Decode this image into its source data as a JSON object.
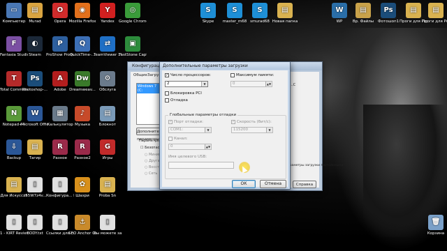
{
  "desktop": {
    "icons": [
      {
        "label": "Компьютер",
        "icon": "computer-icon",
        "color": "#4a78b5",
        "glyph": "▭"
      },
      {
        "label": "Murad",
        "icon": "folder-icon",
        "color": "#d9a441",
        "glyph": "▤"
      },
      {
        "label": "Opera",
        "icon": "opera-icon",
        "color": "#d12b2b",
        "glyph": "O"
      },
      {
        "label": "Mozilla Firefox",
        "icon": "firefox-icon",
        "color": "#e3701c",
        "glyph": "◉"
      },
      {
        "label": "Yandex",
        "icon": "yandex-icon",
        "color": "#d22020",
        "glyph": "Y"
      },
      {
        "label": "Google Chrome",
        "icon": "chrome-icon",
        "color": "#3a9b3a",
        "glyph": "◎"
      },
      {
        "label": "Skype",
        "icon": "skype-icon",
        "color": "#1e8fd6",
        "glyph": "S"
      },
      {
        "label": "master_m68",
        "icon": "skype-icon",
        "color": "#1e8fd6",
        "glyph": "S"
      },
      {
        "label": "smurad68",
        "icon": "skype-icon",
        "color": "#1e8fd6",
        "glyph": "S"
      },
      {
        "label": "Новая папка",
        "icon": "folder-icon",
        "color": "#d9b250",
        "glyph": "▤"
      },
      {
        "label": "WP",
        "icon": "wordpress-icon",
        "color": "#2a6ea8",
        "glyph": "W"
      },
      {
        "label": "Вр. Файлы",
        "icon": "folder-icon",
        "color": "#c9a24a",
        "glyph": "▤"
      },
      {
        "label": "Фотошоп1",
        "icon": "photoshop-icon",
        "color": "#1b4d7a",
        "glyph": "Ps"
      },
      {
        "label": "Проги для Рерайта",
        "icon": "folder-icon",
        "color": "#d9b250",
        "glyph": "▤"
      },
      {
        "label": "Проги для Рерайта",
        "icon": "folder-icon",
        "color": "#d9b250",
        "glyph": "▤"
      },
      {
        "label": "Fantasia Studio 7",
        "icon": "fantasia-icon",
        "color": "#7b4fa3",
        "glyph": "F"
      },
      {
        "label": "Steam",
        "icon": "steam-icon",
        "color": "#1b2838",
        "glyph": "◐"
      },
      {
        "label": "ProShow Producer",
        "icon": "proshow-icon",
        "color": "#2d5f9e",
        "glyph": "P"
      },
      {
        "label": "QuickTime-...",
        "icon": "quicktime-icon",
        "color": "#3c6fb6",
        "glyph": "Q"
      },
      {
        "label": "TeamViewer 10",
        "icon": "teamviewer-icon",
        "color": "#1f6fc5",
        "glyph": "⇄"
      },
      {
        "label": "FastStone Capture",
        "icon": "faststone-icon",
        "color": "#2d8c3c",
        "glyph": "▣"
      },
      {
        "label": "Total Commander",
        "icon": "totalcmd-icon",
        "color": "#b52a2a",
        "glyph": "T"
      },
      {
        "label": "Photoshop-...",
        "icon": "photoshop-icon",
        "color": "#1b4d7a",
        "glyph": "Ps"
      },
      {
        "label": "Adobe",
        "icon": "adobe-icon",
        "color": "#b31e1e",
        "glyph": "A"
      },
      {
        "label": "Dreamweav...",
        "icon": "dreamweaver-icon",
        "color": "#3a7a2a",
        "glyph": "Dw"
      },
      {
        "label": "Обслуга",
        "icon": "service-icon",
        "color": "#6b7b8c",
        "glyph": "⚙"
      },
      {
        "label": "Notepad++",
        "icon": "notepad-icon",
        "color": "#5a9a3a",
        "glyph": "N"
      },
      {
        "label": "Microsoft Office W...",
        "icon": "word-icon",
        "color": "#2b5797",
        "glyph": "W"
      },
      {
        "label": "Калькулятор",
        "icon": "calculator-icon",
        "color": "#6a7a8a",
        "glyph": "▦"
      },
      {
        "label": "Музыка",
        "icon": "music-icon",
        "color": "#c74a2a",
        "glyph": "♪"
      },
      {
        "label": "Блокнот",
        "icon": "notepad-icon",
        "color": "#7a9ab8",
        "glyph": "▤"
      },
      {
        "label": "Backup",
        "icon": "backup-icon",
        "color": "#2b5797",
        "glyph": "⇩"
      },
      {
        "label": "Тагир",
        "icon": "folder-icon",
        "color": "#d9b250",
        "glyph": "▤"
      },
      {
        "label": "Разное",
        "icon": "winrar-icon",
        "color": "#9a2a4a",
        "glyph": "R"
      },
      {
        "label": "Разное2",
        "icon": "winrar-icon",
        "color": "#9a2a4a",
        "glyph": "R"
      },
      {
        "label": "Игры",
        "icon": "games-icon",
        "color": "#c22a2a",
        "glyph": "G"
      },
      {
        "label": "Для Искусств",
        "icon": "folder-icon",
        "color": "#d9b250",
        "glyph": "▤"
      },
      {
        "label": "z55W7z4v...",
        "icon": "file-icon",
        "color": "#e0e0e0",
        "glyph": "▯"
      },
      {
        "label": "Конфигура... ПК.txt",
        "icon": "text-file-icon",
        "color": "#e0e0e0",
        "glyph": "▯"
      },
      {
        "label": "Шахри",
        "icon": "butterfly-icon",
        "color": "#d8901c",
        "glyph": "✿"
      },
      {
        "label": "Proba Sn",
        "icon": "folder-icon",
        "color": "#d9b250",
        "glyph": "▤"
      },
      {
        "label": "1 - KIRT Review",
        "icon": "text-file-icon",
        "color": "#e0e0e0",
        "glyph": "▯"
      },
      {
        "label": "BODY.txt",
        "icon": "text-file-icon",
        "color": "#e0e0e0",
        "glyph": "▯"
      },
      {
        "label": "Ссылки для скачивани...",
        "icon": "text-file-icon",
        "color": "#e0e0e0",
        "glyph": "▯"
      },
      {
        "label": "SEO Anchor Generator...",
        "icon": "seo-icon",
        "color": "#c98a2a",
        "glyph": "⚓"
      },
      {
        "label": "Вы можете заказать.txt",
        "icon": "text-file-icon",
        "color": "#e0e0e0",
        "glyph": "▯"
      },
      {
        "label": "Корзина",
        "icon": "recycle-bin-icon",
        "color": "#7aa0c8",
        "glyph": "🗑"
      }
    ]
  },
  "back_window": {
    "title": "Конфигурация системы",
    "tabs": [
      "Общие",
      "Загрузка"
    ],
    "list_item": "Windows 7 (C:",
    "advanced_button": "Дополнительные параметры...",
    "boot_params_label": "Параметры загрузки",
    "safe_mode_label": "Безопасный режим",
    "radio_options": [
      "Минимальная",
      "Другая оболочка",
      "Восстановление",
      "Сеть"
    ],
    "timeout_hint": "параметры загрузки постоянными",
    "help_button": "Справка",
    "right_text": "...C"
  },
  "dialog": {
    "title": "Дополнительные параметры загрузки",
    "num_processors": {
      "label": "Число процессоров:",
      "checked": true,
      "value": "2"
    },
    "max_memory": {
      "label": "Максимум памяти:",
      "checked": false,
      "value": "0"
    },
    "pci_lock": {
      "label": "Блокировка PCI",
      "checked": false
    },
    "debug": {
      "label": "Отладка",
      "checked": false
    },
    "global_debug": {
      "title": "Глобальные параметры отладки",
      "debug_port": {
        "label": "Порт отладки:",
        "checked": true,
        "value": "COM1:"
      },
      "baud_rate": {
        "label": "Скорость (бит/с):",
        "checked": true,
        "value": "115200"
      },
      "channel": {
        "label": "Канал:",
        "checked": false,
        "value": "0"
      },
      "usb_target": {
        "label": "Имя целевого USB:",
        "value": ""
      }
    },
    "ok_button": "ОК",
    "cancel_button": "Отмена"
  }
}
